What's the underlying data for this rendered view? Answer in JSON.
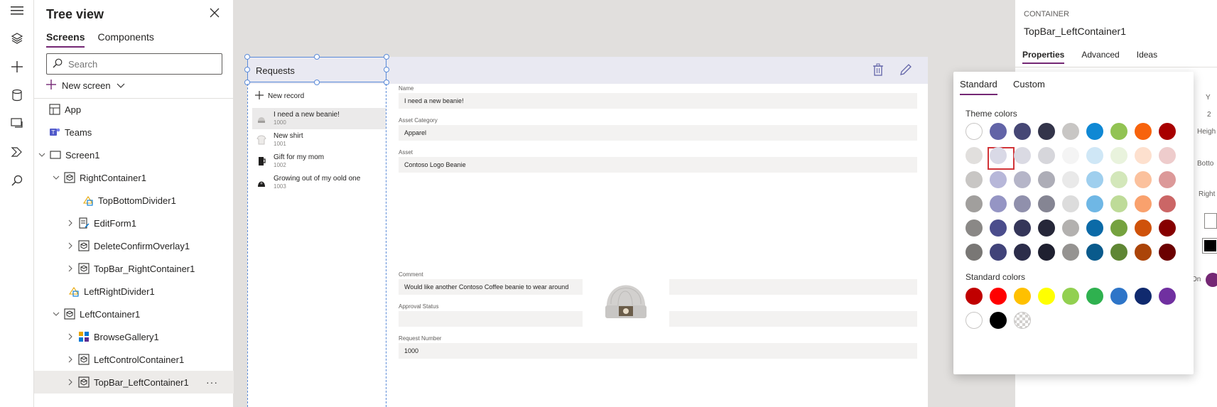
{
  "tree": {
    "title": "Tree view",
    "tabs": [
      "Screens",
      "Components"
    ],
    "search_placeholder": "Search",
    "new_screen": "New screen",
    "nodes": [
      {
        "label": "App"
      },
      {
        "label": "Teams"
      },
      {
        "label": "Screen1"
      },
      {
        "label": "RightContainer1"
      },
      {
        "label": "TopBottomDivider1"
      },
      {
        "label": "EditForm1"
      },
      {
        "label": "DeleteConfirmOverlay1"
      },
      {
        "label": "TopBar_RightContainer1"
      },
      {
        "label": "LeftRightDivider1"
      },
      {
        "label": "LeftContainer1"
      },
      {
        "label": "BrowseGallery1"
      },
      {
        "label": "LeftControlContainer1"
      },
      {
        "label": "TopBar_LeftContainer1"
      }
    ],
    "more": "···"
  },
  "app": {
    "title": "Requests",
    "new_record": "New record",
    "gallery": [
      {
        "title": "I need a new beanie!",
        "sub": "1000"
      },
      {
        "title": "New shirt",
        "sub": "1001"
      },
      {
        "title": "Gift for my mom",
        "sub": "1002"
      },
      {
        "title": "Growing out of my oold one",
        "sub": "1003"
      }
    ],
    "form": [
      {
        "label": "Name",
        "value": "I need a new beanie!"
      },
      {
        "label": "Asset Category",
        "value": "Apparel"
      },
      {
        "label": "Asset",
        "value": "Contoso Logo Beanie"
      },
      {
        "label": "Comment",
        "value": "Would like another Contoso Coffee beanie to wear around"
      },
      {
        "label": "Approval Status",
        "value": ""
      },
      {
        "label": "Request Number",
        "value": "1000"
      }
    ]
  },
  "props": {
    "kind": "CONTAINER",
    "name": "TopBar_LeftContainer1",
    "tabs": [
      "Properties",
      "Advanced",
      "Ideas"
    ],
    "peek": [
      "Y",
      "2",
      "Heigh",
      "Botto",
      "Right",
      "On"
    ]
  },
  "picker": {
    "tabs": [
      "Standard",
      "Custom"
    ],
    "theme_label": "Theme colors",
    "standard_label": "Standard colors",
    "theme_rows": [
      [
        "#ffffff",
        "#6264a7",
        "#464775",
        "#33344a",
        "#c8c6c4",
        "#0f88d4",
        "#92c353",
        "#f7630c",
        "#a80000"
      ],
      [
        "#e1dfdd",
        "#d9d9e6",
        "#dadae3",
        "#d6d6db",
        "#f4f4f4",
        "#cfe7f6",
        "#e9f3dd",
        "#fde0ce",
        "#eecccc"
      ],
      [
        "#c8c6c4",
        "#b7b7d9",
        "#b5b5c8",
        "#adadb7",
        "#e9e9e9",
        "#9fcfee",
        "#d3e7ba",
        "#fbc19d",
        "#dc9999"
      ],
      [
        "#a19f9d",
        "#9595c4",
        "#9090ac",
        "#858593",
        "#dcdcdc",
        "#6fb7e5",
        "#bedb98",
        "#f9a16d",
        "#cb6666"
      ],
      [
        "#8a8886",
        "#4b4d8c",
        "#353659",
        "#262739",
        "#b3b1af",
        "#0b6aa7",
        "#75a23f",
        "#cf520a",
        "#860000"
      ],
      [
        "#797775",
        "#414379",
        "#2c2d4a",
        "#1f2030",
        "#959391",
        "#095a8c",
        "#5f8634",
        "#ab4408",
        "#6b0000"
      ]
    ],
    "standard_rows": [
      [
        "#c00000",
        "#ff0000",
        "#ffc000",
        "#ffff00",
        "#92d050",
        "#2fb14f",
        "#2e75c8",
        "#102a6e",
        "#7030a0"
      ],
      [
        "#ffffff",
        "#000000",
        "transparent"
      ]
    ],
    "highlight": "#d13438"
  }
}
